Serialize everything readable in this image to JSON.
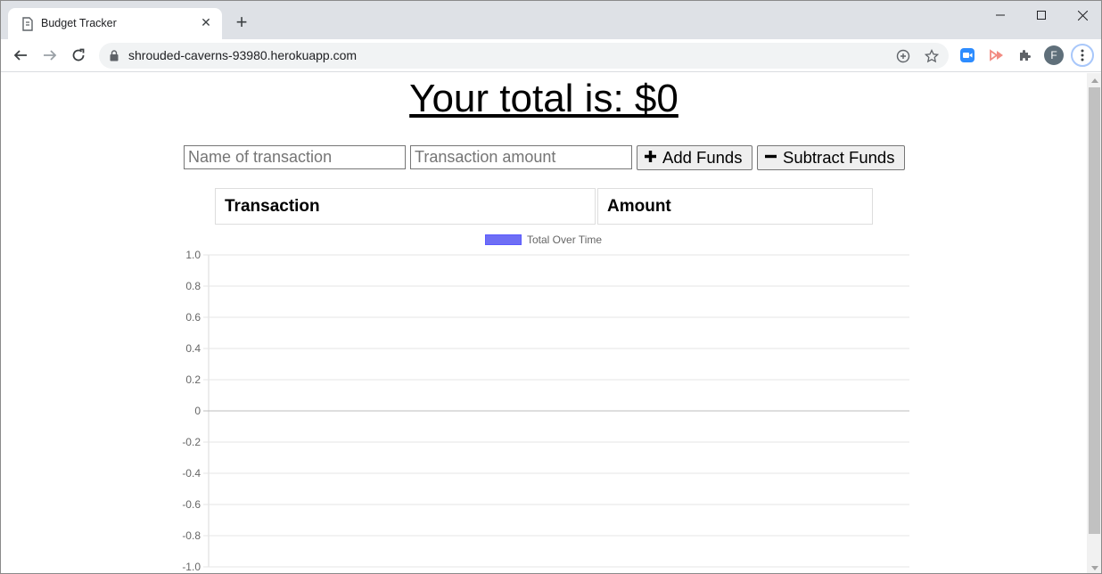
{
  "browser": {
    "tab_title": "Budget Tracker",
    "url": "shrouded-caverns-93980.herokuapp.com",
    "profile_initial": "F"
  },
  "page": {
    "total_text": "Your total is: $0",
    "name_placeholder": "Name of transaction",
    "amount_placeholder": "Transaction amount",
    "add_label": "Add Funds",
    "subtract_label": "Subtract Funds",
    "table_headers": [
      "Transaction",
      "Amount"
    ]
  },
  "chart_data": {
    "type": "line",
    "series": [
      {
        "name": "Total Over Time",
        "values": []
      }
    ],
    "legend_color": "#6e6ef5",
    "ylim": [
      -1.0,
      1.0
    ],
    "y_ticks": [
      "1.0",
      "0.8",
      "0.6",
      "0.4",
      "0.2",
      "0",
      "-0.2",
      "-0.4",
      "-0.6",
      "-0.8",
      "-1.0"
    ],
    "legend_position": "top-center",
    "grid": true
  }
}
